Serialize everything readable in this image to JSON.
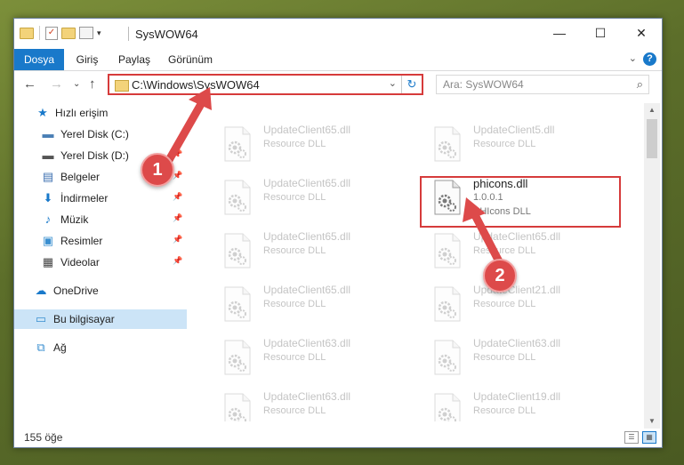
{
  "window": {
    "title": "SysWOW64",
    "controls": {
      "minimize": "—",
      "maximize": "☐",
      "close": "✕"
    }
  },
  "ribbon": {
    "tabs": [
      "Dosya",
      "Giriş",
      "Paylaş",
      "Görünüm"
    ],
    "help": "?"
  },
  "nav": {
    "back": "←",
    "forward": "→",
    "up_list": "⌄",
    "up": "↑",
    "address": "C:\\Windows\\SysWOW64",
    "refresh": "↻",
    "dropdown": "⌄",
    "search_placeholder": "Ara: SysWOW64",
    "search_icon": "⌕"
  },
  "sidebar": {
    "items": [
      {
        "label": "Hızlı erişim",
        "icon": "star-icon",
        "glyph": "★",
        "color": "#1979ca"
      },
      {
        "label": "Yerel Disk (C:)",
        "icon": "drive-icon",
        "glyph": "▬",
        "color": "#4a7fb5"
      },
      {
        "label": "Yerel Disk (D:)",
        "icon": "drive-icon",
        "glyph": "▬",
        "color": "#555555"
      },
      {
        "label": "Belgeler",
        "icon": "documents-icon",
        "glyph": "▤",
        "color": "#3d6fb0"
      },
      {
        "label": "İndirmeler",
        "icon": "download-icon",
        "glyph": "⬇",
        "color": "#1979ca"
      },
      {
        "label": "Müzik",
        "icon": "music-icon",
        "glyph": "♪",
        "color": "#1979ca"
      },
      {
        "label": "Resimler",
        "icon": "pictures-icon",
        "glyph": "▣",
        "color": "#3a8fd0"
      },
      {
        "label": "Videolar",
        "icon": "videos-icon",
        "glyph": "▦",
        "color": "#444444"
      },
      {
        "label": "OneDrive",
        "icon": "onedrive-icon",
        "glyph": "☁",
        "color": "#1979ca"
      },
      {
        "label": "Bu bilgisayar",
        "icon": "computer-icon",
        "glyph": "▭",
        "color": "#3a8fd0"
      },
      {
        "label": "Ağ",
        "icon": "network-icon",
        "glyph": "⧉",
        "color": "#3a8fd0"
      }
    ]
  },
  "files": {
    "left": [
      {
        "name": "UpdateClient65.dll",
        "type": "Resource DLL"
      },
      {
        "name": "UpdateClient65.dll",
        "type": "Resource DLL"
      },
      {
        "name": "UpdateClient65.dll",
        "type": "Resource DLL"
      },
      {
        "name": "UpdateClient65.dll",
        "type": "Resource DLL"
      },
      {
        "name": "UpdateClient63.dll",
        "type": "Resource DLL"
      },
      {
        "name": "UpdateClient63.dll",
        "type": "Resource DLL"
      }
    ],
    "right": [
      {
        "name": "UpdateClient5.dll",
        "type": "Resource DLL"
      },
      {
        "name": "phicons.dll",
        "version": "1.0.0.1",
        "type": "PHIcons DLL"
      },
      {
        "name": "UpdateClient65.dll",
        "type": "Resource DLL"
      },
      {
        "name": "UpdateClient21.dll",
        "type": "Resource DLL"
      },
      {
        "name": "UpdateClient63.dll",
        "type": "Resource DLL"
      },
      {
        "name": "UpdateClient19.dll",
        "type": "Resource DLL"
      }
    ]
  },
  "annotations": {
    "marker1": "1",
    "marker2": "2",
    "color": "#dd4a4a"
  },
  "status": {
    "count": "155 öğe"
  }
}
